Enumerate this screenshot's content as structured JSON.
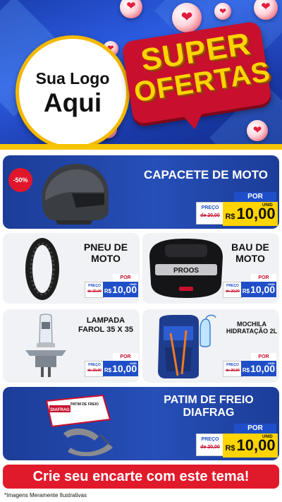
{
  "header": {
    "logo_line1": "Sua Logo",
    "logo_line2": "Aqui",
    "super_word": "SUPER",
    "ofertas_word": "OFERTAS",
    "heart_icon": "heart-icon"
  },
  "colors": {
    "brand_blue": "#1f4fc8",
    "accent_red": "#e11a2b",
    "accent_yellow": "#ffd400"
  },
  "products": [
    {
      "name": "CAPACETE DE MOTO",
      "discount": "-50%",
      "old_label": "PREÇO",
      "old_price": "de 20,00",
      "por_label": "POR",
      "currency": "R$",
      "price": "10,00",
      "unit": "UNID"
    },
    {
      "name": "PNEU DE MOTO",
      "old_label": "PREÇO",
      "old_price": "de 20,00",
      "por_label": "POR",
      "currency": "R$",
      "price": "10,00",
      "unit": "UNID"
    },
    {
      "name": "BAU DE MOTO",
      "old_label": "PREÇO",
      "old_price": "de 20,00",
      "por_label": "POR",
      "currency": "R$",
      "price": "10,00",
      "unit": "UNID",
      "brand_text": "PROOS"
    },
    {
      "name": "LAMPADA FAROL 35 X 35",
      "old_label": "PREÇO",
      "old_price": "de 20,00",
      "por_label": "POR",
      "currency": "R$",
      "price": "10,00",
      "unit": "UNID"
    },
    {
      "name": "MOCHILA HIDRATAÇÃO 2L",
      "old_label": "PREÇO",
      "old_price": "de 20,00",
      "por_label": "POR",
      "currency": "R$",
      "price": "10,00",
      "unit": "UNID"
    },
    {
      "name": "PATIM DE FREIO DIAFRAG",
      "old_label": "PREÇO",
      "old_price": "de 20,00",
      "por_label": "POR",
      "currency": "R$",
      "price": "10,00",
      "unit": "UNID",
      "box_brand": "DIAFRAG",
      "box_title": "PATIM DE FREIO"
    }
  ],
  "cta": "Crie seu encarte com este tema!",
  "disclaimer": "*Imagens Meramente Ilustrativas"
}
